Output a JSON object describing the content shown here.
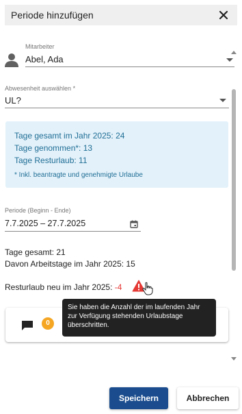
{
  "dialog": {
    "title": "Periode hinzufügen",
    "close_icon": "close-icon"
  },
  "form": {
    "mitarbeiter": {
      "label": "Mitarbeiter",
      "value": "Abel, Ada",
      "icon": "person-icon"
    },
    "abwesenheit": {
      "label": "Abwesenheit auswählen *",
      "value": "UL?"
    },
    "info": {
      "line1": "Tage gesamt im Jahr 2025: 24",
      "line2": "Tage genommen*: 13",
      "line3": "Tage Resturlaub: 11",
      "note": "* Inkl. beantragte und genehmigte Urlaube"
    },
    "periode": {
      "label": "Periode (Beginn - Ende)",
      "value": "7.7.2025 – 27.7.2025",
      "icon": "calendar-icon"
    },
    "stats": {
      "tage_gesamt": "Tage gesamt: 21",
      "arbeitstage": "Davon Arbeitstage im Jahr 2025: 15",
      "resturlaub_label": "Resturlaub neu im Jahr 2025: ",
      "resturlaub_value": "-4"
    },
    "comments": {
      "count": "0",
      "icon": "comment-icon"
    }
  },
  "tooltip": {
    "text": "Sie haben die Anzahl der im laufenden Jahr zur Verfügung stehenden Urlaubstage überschritten."
  },
  "actions": {
    "save": "Speichern",
    "cancel": "Abbrechen"
  },
  "colors": {
    "primary": "#1b4d8e",
    "info_bg": "#e3f1fa",
    "info_text": "#1f6e95",
    "warning": "#e53935",
    "badge": "#f5a623"
  }
}
